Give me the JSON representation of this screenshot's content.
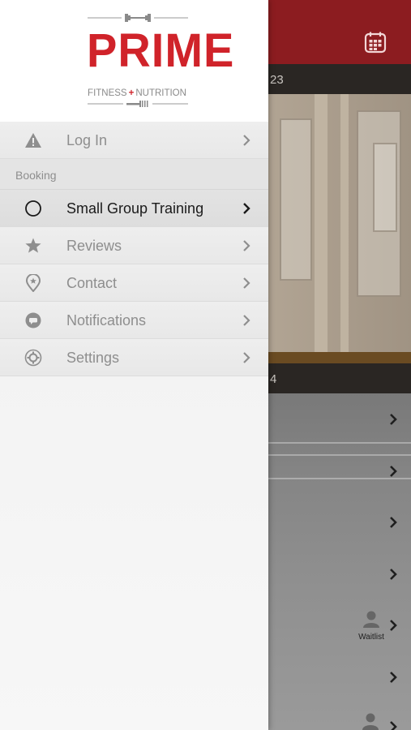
{
  "brand": {
    "name": "PRIME",
    "tagline_left": "FITNESS",
    "tagline_cross": "+",
    "tagline_right": "NUTRITION",
    "accent_color": "#d0232a",
    "header_color": "#8c1c20"
  },
  "background": {
    "date_bar_1": "23",
    "date_bar_2": "4",
    "waitlist_label": "Waitlist"
  },
  "menu": {
    "login": {
      "label": "Log In",
      "icon": "warning-icon"
    },
    "section_booking": "Booking",
    "items": [
      {
        "label": "Small Group Training",
        "icon": "circle-icon",
        "active": true
      },
      {
        "label": "Reviews",
        "icon": "star-icon"
      },
      {
        "label": "Contact",
        "icon": "location-pin-icon"
      },
      {
        "label": "Notifications",
        "icon": "chat-bubble-icon"
      },
      {
        "label": "Settings",
        "icon": "gear-icon"
      }
    ]
  }
}
